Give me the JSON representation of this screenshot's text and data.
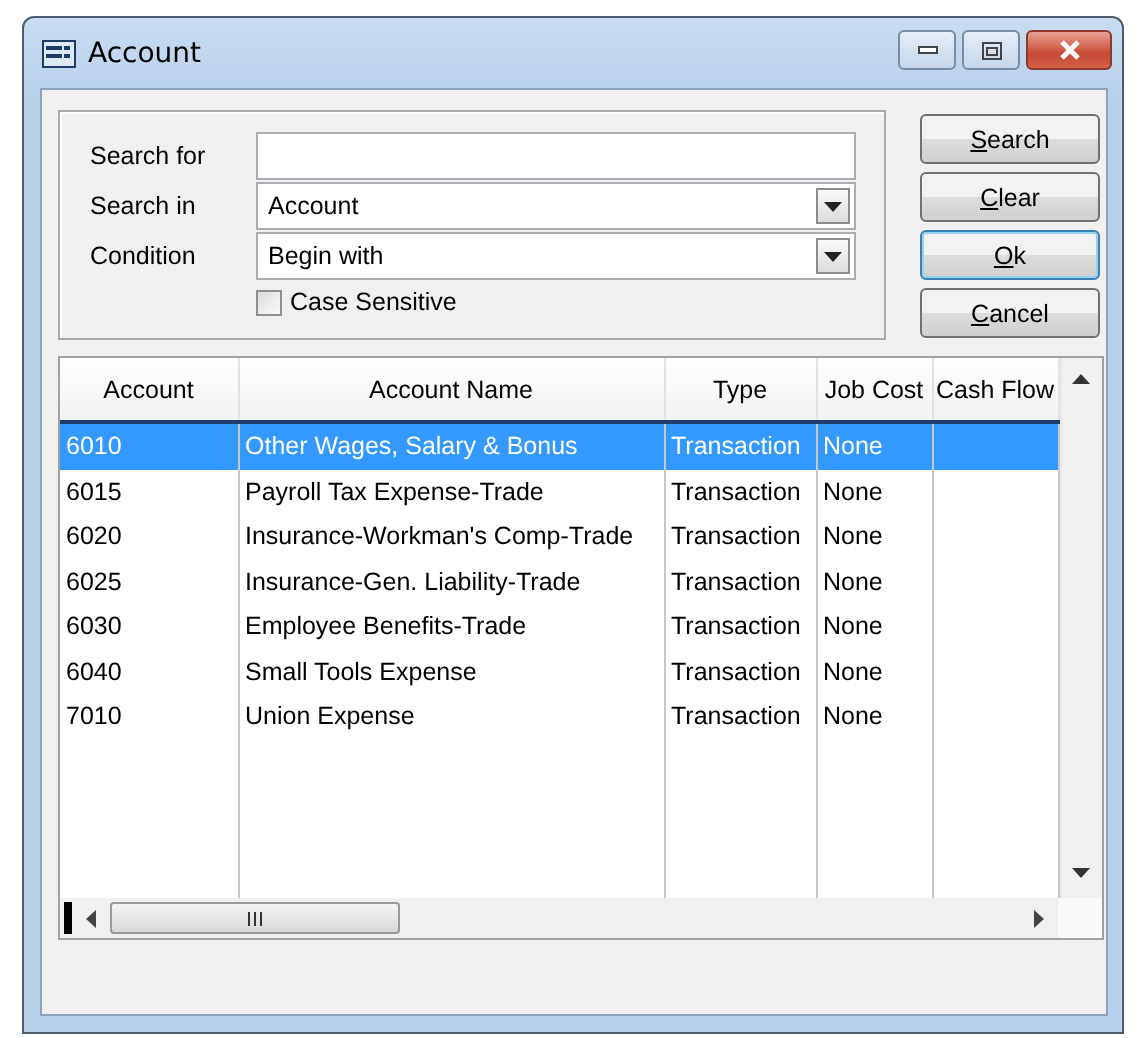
{
  "window": {
    "title": "Account"
  },
  "search_form": {
    "fields": [
      {
        "kind": "text",
        "label": "Search for"
      },
      {
        "kind": "dropdown",
        "label": "Search in",
        "value": "Account"
      },
      {
        "kind": "dropdown",
        "label": "Condition",
        "value": "Begin with"
      }
    ],
    "case_sensitive": {
      "label": "Case Sensitive",
      "checked": false
    }
  },
  "buttons": [
    {
      "label": "Search",
      "focused": false
    },
    {
      "label": "Clear",
      "focused": false
    },
    {
      "label": "Ok",
      "focused": true
    },
    {
      "label": "Cancel",
      "focused": false
    }
  ],
  "table": {
    "columns": [
      "Account",
      "Account Name",
      "Type",
      "Job Cost",
      "Cash Flow"
    ],
    "rows": [
      {
        "selected": true,
        "cells": [
          "6010",
          "Other Wages, Salary & Bonus",
          "Transaction",
          "None",
          ""
        ]
      },
      {
        "selected": false,
        "cells": [
          "6015",
          "Payroll Tax Expense-Trade",
          "Transaction",
          "None",
          ""
        ]
      },
      {
        "selected": false,
        "cells": [
          "6020",
          "Insurance-Workman's Comp-Trade",
          "Transaction",
          "None",
          ""
        ]
      },
      {
        "selected": false,
        "cells": [
          "6025",
          "Insurance-Gen. Liability-Trade",
          "Transaction",
          "None",
          ""
        ]
      },
      {
        "selected": false,
        "cells": [
          "6030",
          "Employee Benefits-Trade",
          "Transaction",
          "None",
          ""
        ]
      },
      {
        "selected": false,
        "cells": [
          "6040",
          "Small Tools Expense",
          "Transaction",
          "None",
          ""
        ]
      },
      {
        "selected": false,
        "cells": [
          "7010",
          "Union Expense",
          "Transaction",
          "None",
          ""
        ]
      }
    ]
  }
}
